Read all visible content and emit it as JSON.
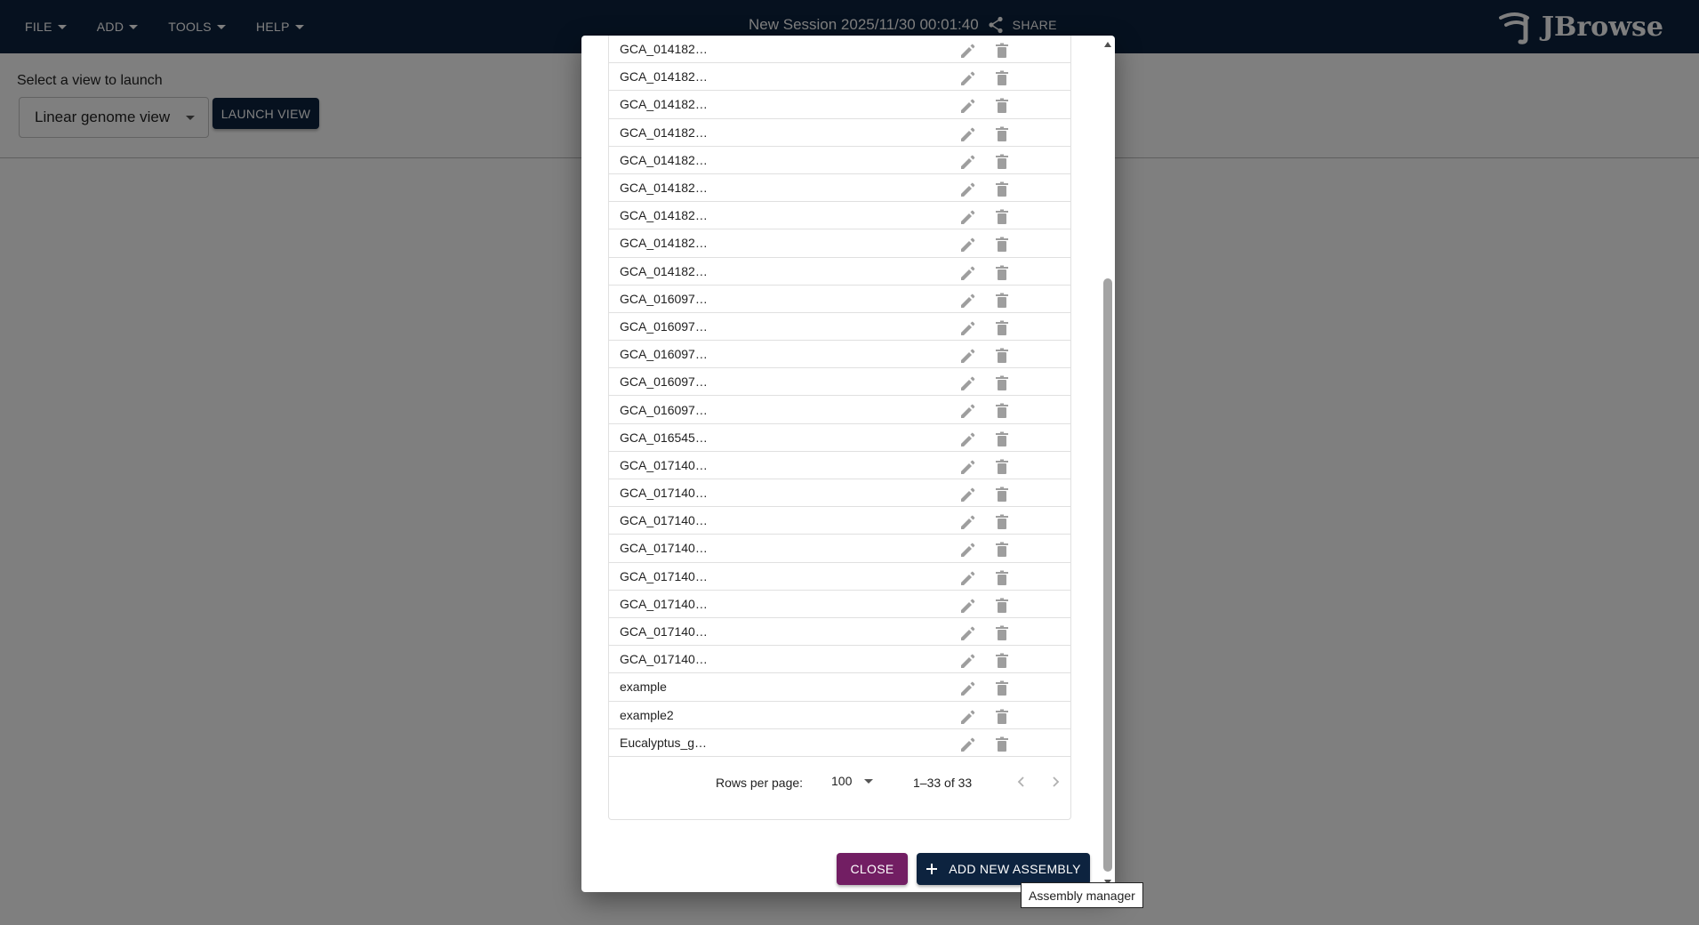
{
  "menu": {
    "items": [
      {
        "label": "FILE"
      },
      {
        "label": "ADD"
      },
      {
        "label": "TOOLS"
      },
      {
        "label": "HELP"
      }
    ]
  },
  "header": {
    "session_title": "New Session 2025/11/30 00:01:40",
    "share_label": "SHARE",
    "logo_text": "JBrowse"
  },
  "launch": {
    "label": "Select a view to launch",
    "selected_view": "Linear genome view",
    "button_label": "LAUNCH VIEW"
  },
  "dialog": {
    "rows": [
      {
        "name": "GCA_014182…"
      },
      {
        "name": "GCA_014182…"
      },
      {
        "name": "GCA_014182…"
      },
      {
        "name": "GCA_014182…"
      },
      {
        "name": "GCA_014182…"
      },
      {
        "name": "GCA_014182…"
      },
      {
        "name": "GCA_014182…"
      },
      {
        "name": "GCA_014182…"
      },
      {
        "name": "GCA_014182…"
      },
      {
        "name": "GCA_016097…"
      },
      {
        "name": "GCA_016097…"
      },
      {
        "name": "GCA_016097…"
      },
      {
        "name": "GCA_016097…"
      },
      {
        "name": "GCA_016097…"
      },
      {
        "name": "GCA_016545…"
      },
      {
        "name": "GCA_017140…"
      },
      {
        "name": "GCA_017140…"
      },
      {
        "name": "GCA_017140…"
      },
      {
        "name": "GCA_017140…"
      },
      {
        "name": "GCA_017140…"
      },
      {
        "name": "GCA_017140…"
      },
      {
        "name": "GCA_017140…"
      },
      {
        "name": "GCA_017140…"
      },
      {
        "name": "example"
      },
      {
        "name": "example2"
      },
      {
        "name": "Eucalyptus_g…"
      }
    ],
    "pagination": {
      "rows_per_page_label": "Rows per page:",
      "rows_per_page_value": "100",
      "range_text": "1–33 of 33"
    },
    "close_label": "CLOSE",
    "add_label": "ADD NEW ASSEMBLY"
  },
  "tooltip": {
    "text": "Assembly manager"
  },
  "colors": {
    "appbar": "#0d233f",
    "close_button": "#721e63",
    "primary_button": "#0d233f",
    "icon_gray": "#9e9e9e"
  }
}
